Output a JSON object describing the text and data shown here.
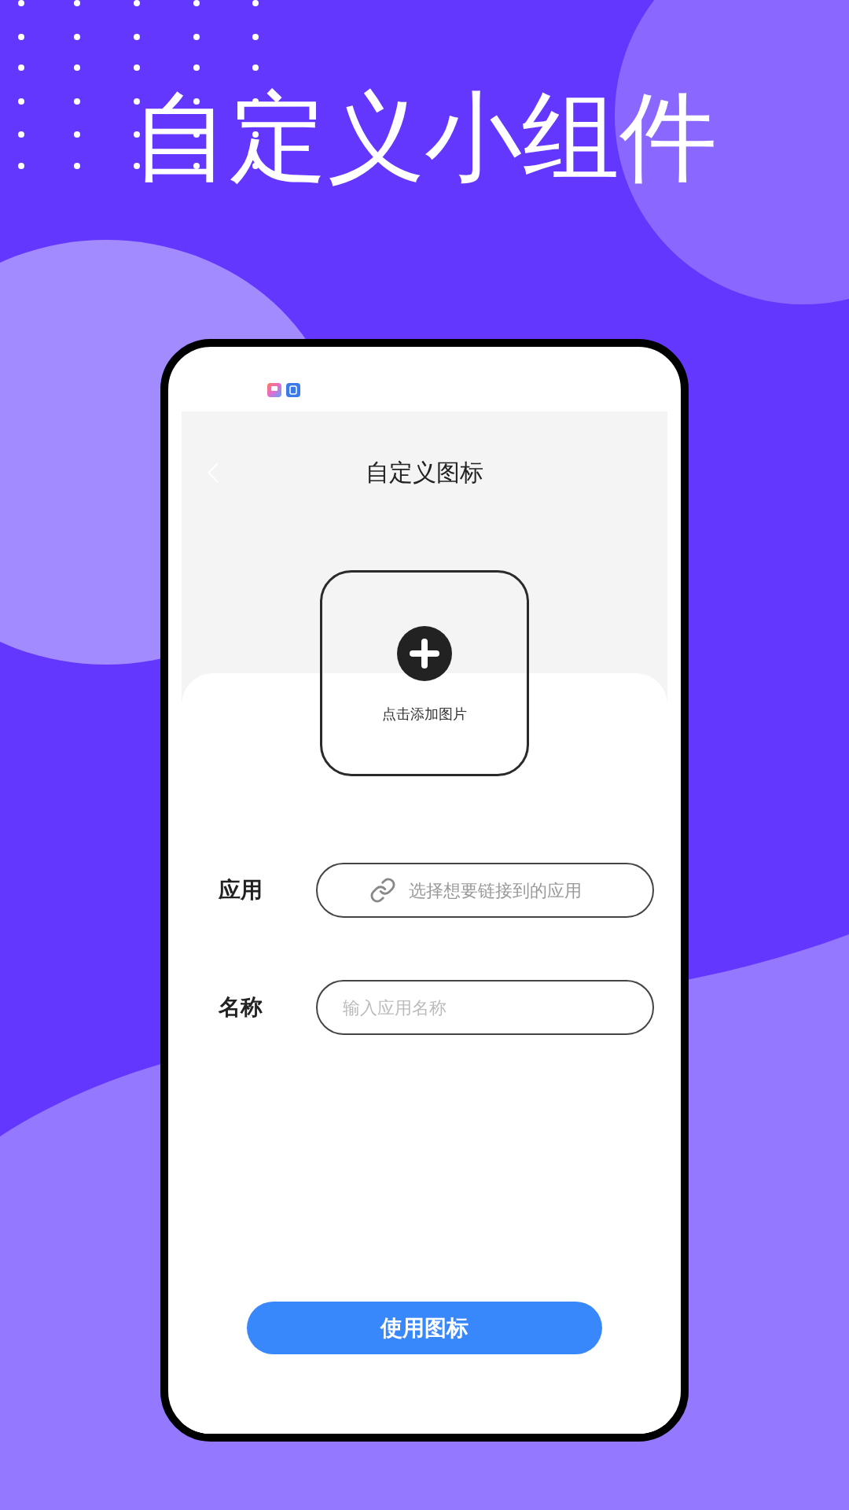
{
  "promo_title": "自定义小组件",
  "screen": {
    "nav": {
      "title": "自定义图标"
    },
    "image_picker": {
      "label": "点击添加图片"
    },
    "form": [
      {
        "label": "应用",
        "kind": "select",
        "placeholder": "选择想要链接到的应用"
      },
      {
        "label": "名称",
        "kind": "input",
        "placeholder": "输入应用名称"
      }
    ],
    "submit_button": "使用图标"
  }
}
